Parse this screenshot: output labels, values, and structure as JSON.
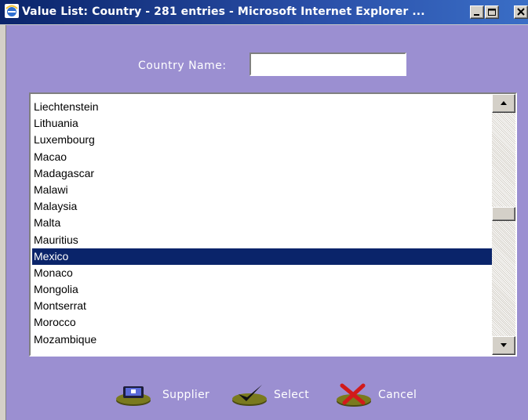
{
  "window": {
    "title": "Value List: Country - 281 entries - Microsoft Internet Explorer ...",
    "controls": [
      "minimize",
      "maximize",
      "close"
    ]
  },
  "search": {
    "label": "Country Name:",
    "value": ""
  },
  "list": {
    "items": [
      "Liechtenstein",
      "Lithuania",
      "Luxembourg",
      "Macao",
      "Madagascar",
      "Malawi",
      "Malaysia",
      "Malta",
      "Mauritius",
      "Mexico",
      "Monaco",
      "Mongolia",
      "Montserrat",
      "Morocco",
      "Mozambique"
    ],
    "selected": "Mexico"
  },
  "buttons": {
    "supplier": "Supplier",
    "select": "Select",
    "cancel": "Cancel"
  },
  "colors": {
    "background": "#9b8fd1",
    "selection": "#0a246a",
    "titlebar": "#0a246a"
  },
  "icons": [
    "ie-icon",
    "minimize-icon",
    "maximize-icon",
    "close-icon",
    "scroll-up-icon",
    "scroll-down-icon",
    "supplier-icon",
    "checkmark-icon",
    "cancel-x-icon"
  ]
}
